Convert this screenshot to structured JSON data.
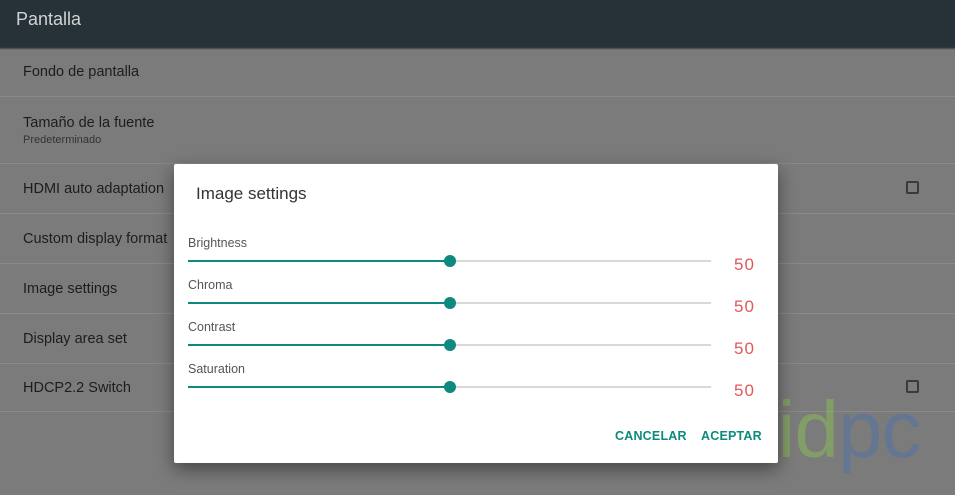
{
  "appbar": {
    "title": "Pantalla"
  },
  "settings": [
    {
      "title": "Fondo de pantalla",
      "subtitle": "",
      "checkbox": false
    },
    {
      "title": "Tamaño de la fuente",
      "subtitle": "Predeterminado",
      "checkbox": false
    },
    {
      "title": "HDMI auto adaptation",
      "subtitle": "",
      "checkbox": true
    },
    {
      "title": "Custom display format",
      "subtitle": "",
      "checkbox": false
    },
    {
      "title": "Image settings",
      "subtitle": "",
      "checkbox": false
    },
    {
      "title": "Display area set",
      "subtitle": "",
      "checkbox": false
    },
    {
      "title": "HDCP2.2 Switch",
      "subtitle": "",
      "checkbox": true
    }
  ],
  "dialog": {
    "title": "Image settings",
    "sliders": [
      {
        "label": "Brightness",
        "value": "50",
        "fraction": 0.5
      },
      {
        "label": "Chroma",
        "value": "50",
        "fraction": 0.5
      },
      {
        "label": "Contrast",
        "value": "50",
        "fraction": 0.5
      },
      {
        "label": "Saturation",
        "value": "50",
        "fraction": 0.5
      }
    ],
    "cancel_label": "CANCELAR",
    "accept_label": "ACEPTAR"
  },
  "watermark": {
    "part1": "android",
    "part2": "pc"
  },
  "colors": {
    "accent": "#0d8a7d",
    "value_text": "#e05858",
    "appbar": "#263238"
  }
}
